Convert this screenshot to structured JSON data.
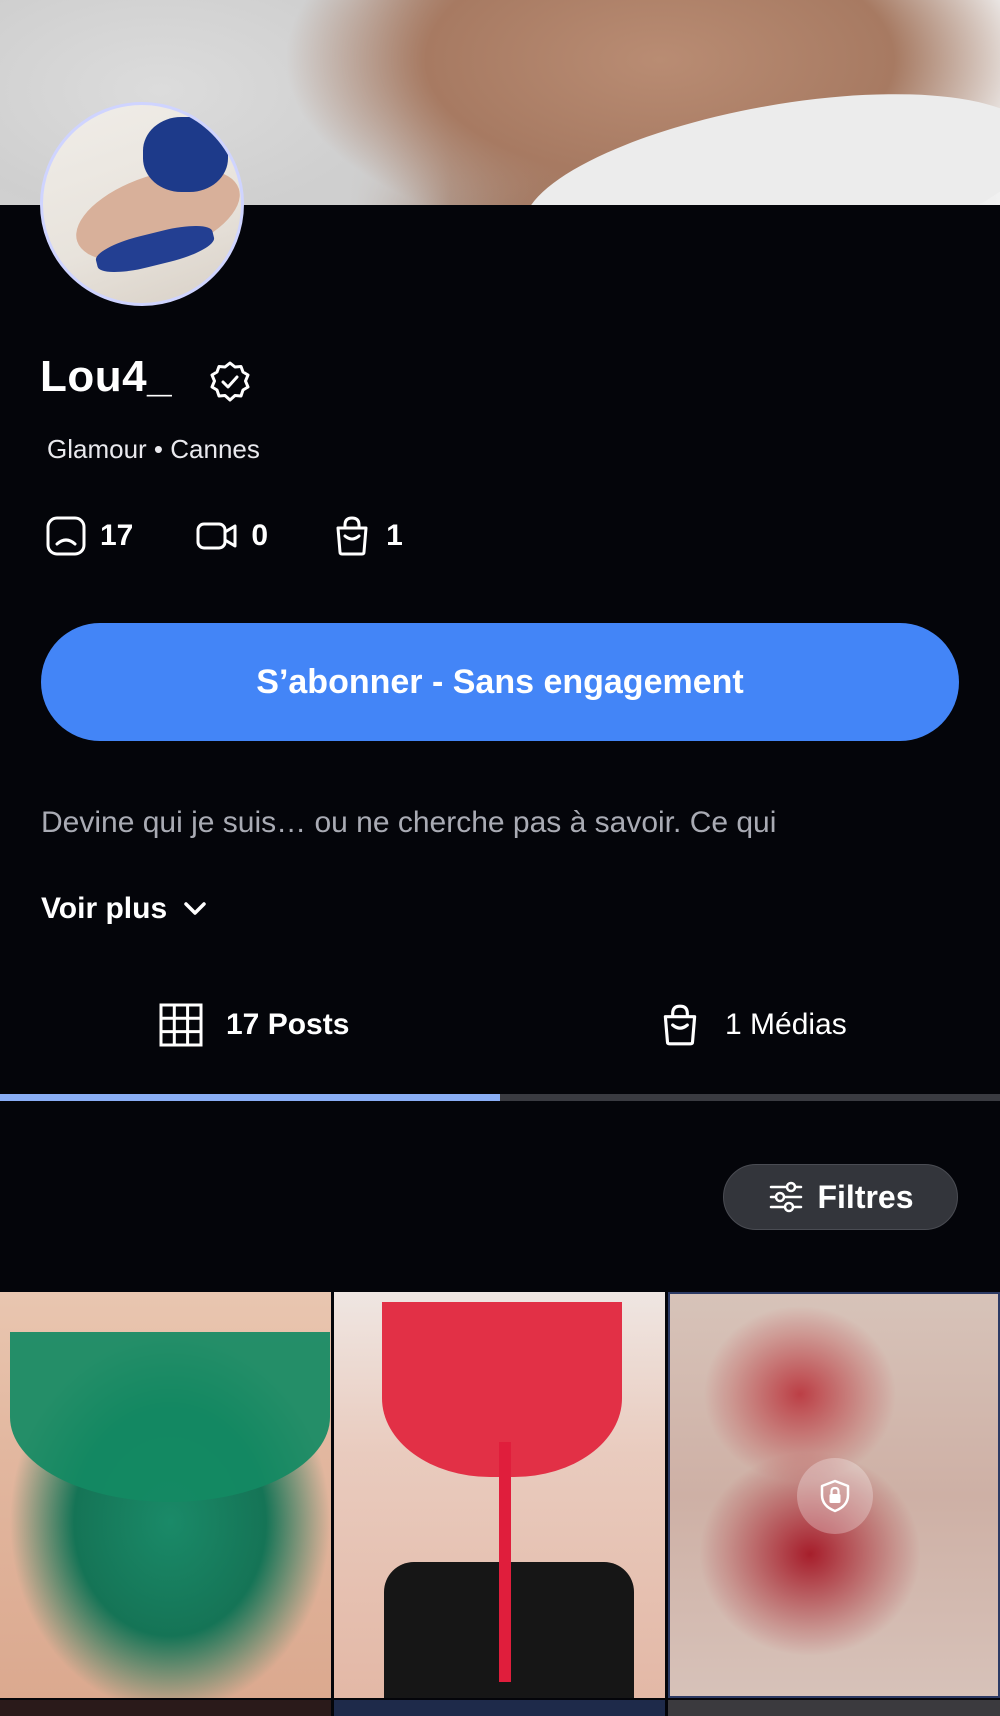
{
  "profile": {
    "name": "Lou4_",
    "meta": "Glamour • Cannes",
    "stats": {
      "posts": "17",
      "videos": "0",
      "media": "1"
    },
    "subscribe_label": "S’abonner - Sans engagement",
    "bio": "Devine qui je suis… ou ne cherche pas à savoir. Ce qui",
    "more_label": "Voir plus"
  },
  "tabs": [
    {
      "label": "17 Posts",
      "icon": "grid-icon",
      "active": true
    },
    {
      "label": "1 Médias",
      "icon": "shopping-bag-icon",
      "active": false
    }
  ],
  "filters_label": "Filtres",
  "colors": {
    "background": "#04050a",
    "accent": "#4385f7",
    "tab_indicator": "#8aaef5"
  },
  "grid": {
    "tiles": [
      {
        "locked": false
      },
      {
        "locked": false
      },
      {
        "locked": true,
        "icon": "lock-icon"
      }
    ]
  }
}
